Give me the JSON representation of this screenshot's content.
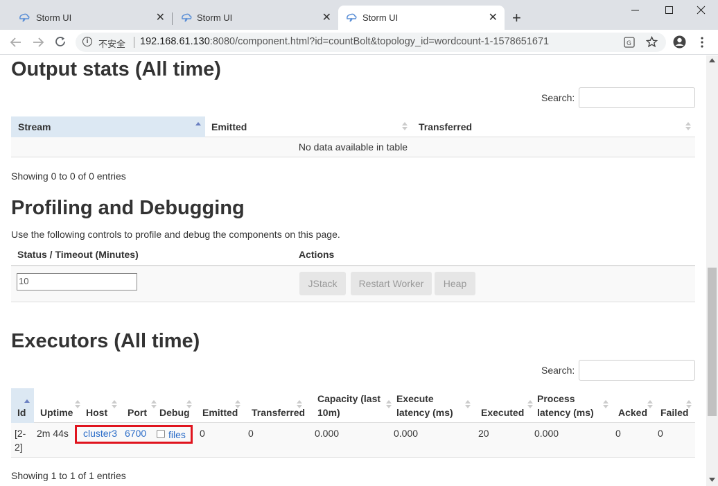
{
  "browser": {
    "tabs": [
      {
        "title": "Storm UI",
        "active": false
      },
      {
        "title": "Storm UI",
        "active": false
      },
      {
        "title": "Storm UI",
        "active": true
      }
    ],
    "close_glyph": "✕",
    "new_tab_glyph": "+",
    "insecure_label": "不安全",
    "url_host": "192.168.61.130",
    "url_rest": ":8080/component.html?id=countBolt&topology_id=wordcount-1-1578651671"
  },
  "output_stats": {
    "heading": "Output stats (All time)",
    "search_label": "Search:",
    "columns": [
      "Stream",
      "Emitted",
      "Transferred"
    ],
    "empty_message": "No data available in table",
    "entries_info": "Showing 0 to 0 of 0 entries"
  },
  "profiling": {
    "heading": "Profiling and Debugging",
    "description": "Use the following controls to profile and debug the components on this page.",
    "col_status": "Status / Timeout (Minutes)",
    "col_actions": "Actions",
    "timeout_value": "10",
    "buttons": {
      "jstack": "JStack",
      "restart": "Restart Worker",
      "heap": "Heap"
    }
  },
  "executors": {
    "heading": "Executors (All time)",
    "search_label": "Search:",
    "columns": {
      "id": "Id",
      "uptime": "Uptime",
      "host": "Host",
      "port": "Port",
      "debug": "Debug",
      "emitted": "Emitted",
      "transferred": "Transferred",
      "capacity_1": "Capacity (last",
      "capacity_2": "10m)",
      "exec_lat_1": "Execute",
      "exec_lat_2": "latency (ms)",
      "executed": "Executed",
      "proc_lat_1": "Process",
      "proc_lat_2": "latency (ms)",
      "acked": "Acked",
      "failed": "Failed"
    },
    "row": {
      "id_1": "[2-",
      "id_2": "2]",
      "uptime": "2m 44s",
      "host": "cluster3",
      "port": "6700",
      "files": "files",
      "emitted": "0",
      "transferred": "0",
      "capacity": "0.000",
      "execute_latency": "0.000",
      "executed": "20",
      "process_latency": "0.000",
      "acked": "0",
      "failed": "0"
    },
    "entries_info": "Showing 1 to 1 of 1 entries"
  }
}
